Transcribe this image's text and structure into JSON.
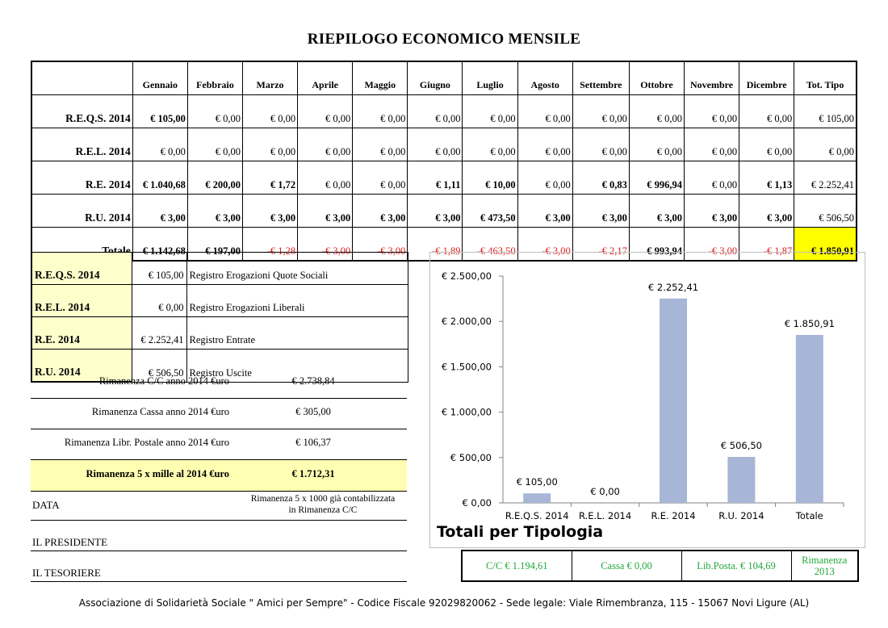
{
  "title": "RIEPILOGO ECONOMICO MENSILE",
  "months": [
    "Gennaio",
    "Febbraio",
    "Marzo",
    "Aprile",
    "Maggio",
    "Giugno",
    "Luglio",
    "Agosto",
    "Settembre",
    "Ottobre",
    "Novembre",
    "Dicembre",
    "Tot. Tipo"
  ],
  "rows": [
    {
      "label": "R.E.Q.S. 2014",
      "cells": [
        "€ 105,00",
        "€ 0,00",
        "€ 0,00",
        "€ 0,00",
        "€ 0,00",
        "€ 0,00",
        "€ 0,00",
        "€ 0,00",
        "€ 0,00",
        "€ 0,00",
        "€ 0,00",
        "€ 0,00",
        "€ 105,00"
      ],
      "bold": [
        true,
        false,
        false,
        false,
        false,
        false,
        false,
        false,
        false,
        false,
        false,
        false,
        false
      ],
      "neg": [
        false,
        false,
        false,
        false,
        false,
        false,
        false,
        false,
        false,
        false,
        false,
        false,
        false
      ]
    },
    {
      "label": "R.E.L. 2014",
      "cells": [
        "€ 0,00",
        "€ 0,00",
        "€ 0,00",
        "€ 0,00",
        "€ 0,00",
        "€ 0,00",
        "€ 0,00",
        "€ 0,00",
        "€ 0,00",
        "€ 0,00",
        "€ 0,00",
        "€ 0,00",
        "€ 0,00"
      ],
      "bold": [
        false,
        false,
        false,
        false,
        false,
        false,
        false,
        false,
        false,
        false,
        false,
        false,
        false
      ],
      "neg": [
        false,
        false,
        false,
        false,
        false,
        false,
        false,
        false,
        false,
        false,
        false,
        false,
        false
      ]
    },
    {
      "label": "R.E. 2014",
      "cells": [
        "€ 1.040,68",
        "€ 200,00",
        "€ 1,72",
        "€ 0,00",
        "€ 0,00",
        "€ 1,11",
        "€ 10,00",
        "€ 0,00",
        "€ 0,83",
        "€ 996,94",
        "€ 0,00",
        "€ 1,13",
        "€ 2.252,41"
      ],
      "bold": [
        true,
        true,
        true,
        false,
        false,
        true,
        true,
        false,
        true,
        true,
        false,
        true,
        false
      ],
      "neg": [
        false,
        false,
        false,
        false,
        false,
        false,
        false,
        false,
        false,
        false,
        false,
        false,
        false
      ]
    },
    {
      "label": "R.U. 2014",
      "cells": [
        "€ 3,00",
        "€ 3,00",
        "€ 3,00",
        "€ 3,00",
        "€ 3,00",
        "€ 3,00",
        "€ 473,50",
        "€ 3,00",
        "€ 3,00",
        "€ 3,00",
        "€ 3,00",
        "€ 3,00",
        "€ 506,50"
      ],
      "bold": [
        true,
        true,
        true,
        true,
        true,
        true,
        true,
        true,
        true,
        true,
        true,
        true,
        false
      ],
      "neg": [
        false,
        false,
        false,
        false,
        false,
        false,
        false,
        false,
        false,
        false,
        false,
        false,
        false
      ]
    },
    {
      "label": "Totale",
      "cells": [
        "€ 1.142,68",
        "€ 197,00",
        "-€ 1,28",
        "-€ 3,00",
        "-€ 3,00",
        "-€ 1,89",
        "-€ 463,50",
        "-€ 3,00",
        "-€ 2,17",
        "€ 993,94",
        "-€ 3,00",
        "-€ 1,87",
        "€ 1.850,91"
      ],
      "bold": [
        true,
        true,
        false,
        false,
        false,
        false,
        false,
        false,
        false,
        true,
        false,
        false,
        true
      ],
      "neg": [
        false,
        false,
        true,
        true,
        true,
        true,
        true,
        true,
        true,
        false,
        true,
        true,
        false
      ]
    }
  ],
  "legend": [
    {
      "code": "R.E.Q.S. 2014",
      "value": "€ 105,00",
      "desc": "Registro Erogazioni Quote Sociali"
    },
    {
      "code": "R.E.L. 2014",
      "value": "€ 0,00",
      "desc": "Registro Erogazioni Liberali"
    },
    {
      "code": "R.E. 2014",
      "value": "€ 2.252,41",
      "desc": "Registro Entrate"
    },
    {
      "code": "R.U. 2014",
      "value": "€ 506,50",
      "desc": "Registro Uscite"
    }
  ],
  "rimanenze": [
    {
      "label": "Rimanenza C/C anno 2014 €uro",
      "value": "€ 2.738,84"
    },
    {
      "label": "Rimanenza Cassa anno 2014 €uro",
      "value": "€ 305,00"
    },
    {
      "label": "Rimanenza Libr. Postale anno 2014 €uro",
      "value": "€ 106,37"
    },
    {
      "label": "Rimanenza 5 x mille al 2014 €uro",
      "value": "€ 1.712,31"
    }
  ],
  "signatures": {
    "data": "DATA",
    "presidente": "IL PRESIDENTE",
    "tesoriere": "IL TESORIERE"
  },
  "note": {
    "line1": "Rimanenza 5 x 1000 già contabilizzata",
    "line2": "in Rimanenza C/C"
  },
  "chart_data": {
    "type": "bar",
    "title": "Totali per  Tipologia",
    "categories": [
      "R.E.Q.S. 2014",
      "R.E.L. 2014",
      "R.E. 2014",
      "R.U. 2014",
      "Totale"
    ],
    "values": [
      105.0,
      0.0,
      2252.41,
      506.5,
      1850.91
    ],
    "data_labels": [
      "€ 105,00",
      "€ 0,00",
      "€ 2.252,41",
      "€ 506,50",
      "€ 1.850,91"
    ],
    "ylim": [
      0,
      2500
    ],
    "yticks": [
      "€ 0,00",
      "€ 500,00",
      "€ 1.000,00",
      "€ 1.500,00",
      "€ 2.000,00",
      "€ 2.500,00"
    ],
    "bar_color": "#a7b5d6",
    "grid": false
  },
  "bottom": {
    "cc": "C/C € 1.194,61",
    "cassa": "Cassa € 0,00",
    "libposta": "Lib.Posta. € 104,69",
    "rim_line1": "Rimanenza",
    "rim_line2": "2013",
    "color": "#21a83a"
  },
  "footer": "Associazione  di Solidarietà Sociale \" Amici per Sempre\" - Codice Fiscale 92029820062 - Sede legale: Viale Rimembranza, 115 - 15067 Novi Ligure (AL)"
}
